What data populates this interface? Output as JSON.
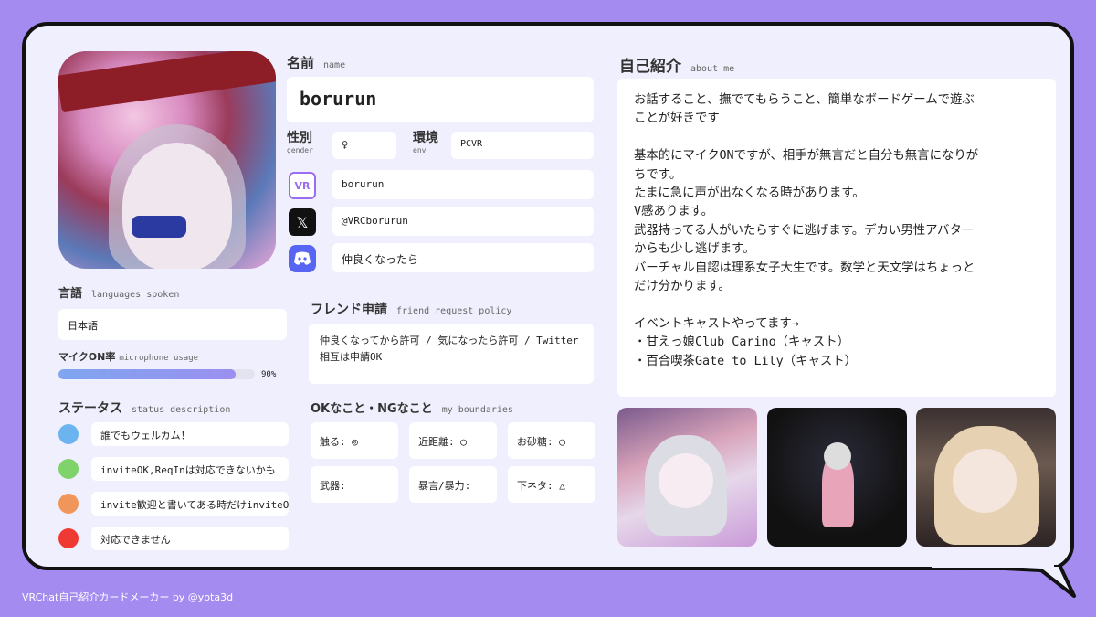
{
  "name": {
    "label": "名前",
    "sub": "name",
    "value": "borurun"
  },
  "gender": {
    "label": "性別",
    "sub": "gender",
    "value": "♀"
  },
  "env": {
    "label": "環境",
    "sub": "env",
    "value": "PCVR"
  },
  "accounts": {
    "vrchat": {
      "icon": "vrchat-icon",
      "icon_text": "VR",
      "value": "borurun"
    },
    "twitter": {
      "icon": "x-icon",
      "icon_text": "𝕏",
      "value": "@VRCborurun"
    },
    "discord": {
      "icon": "discord-icon",
      "value": "仲良くなったら"
    }
  },
  "languages": {
    "label": "言語",
    "sub": "languages spoken",
    "value": "日本語"
  },
  "mic": {
    "label": "マイクON率",
    "sub": "microphone usage",
    "percent": 90,
    "percent_text": "90%"
  },
  "status": {
    "label": "ステータス",
    "sub": "status description",
    "items": [
      {
        "color": "#6cb4f0",
        "text": "誰でもウェルカム！"
      },
      {
        "color": "#7fd36a",
        "text": "inviteOK,ReqInは対応できないかも"
      },
      {
        "color": "#f0965a",
        "text": "invite歓迎と書いてある時だけinviteOK"
      },
      {
        "color": "#ee3a32",
        "text": "対応できません"
      }
    ]
  },
  "friend": {
    "label": "フレンド申請",
    "sub": "friend request policy",
    "value": "仲良くなってから許可 / 気になったら許可 / Twitter相互は申請OK"
  },
  "boundaries": {
    "label": "OKなこと・NGなこと",
    "sub": "my boundaries",
    "items": [
      "触る: ◎",
      "近距離: ◯",
      "お砂糖: ◯",
      "武器:",
      "暴言/暴力:",
      "下ネタ: △"
    ]
  },
  "about": {
    "label": "自己紹介",
    "sub": "about me",
    "lines": [
      "お話すること、撫でてもらうこと、簡単なボードゲームで遊ぶ",
      "ことが好きです",
      "",
      "基本的にマイクONですが、相手が無言だと自分も無言になりが",
      "ちです。",
      "たまに急に声が出なくなる時があります。",
      "V感あります。",
      "武器持ってる人がいたらすぐに逃げます。デカい男性アバター",
      "からも少し逃げます。",
      "バーチャル自認は理系女子大生です。数学と天文学はちょっと",
      "だけ分かります。",
      "",
      "イベントキャストやってます→",
      "・甘えっ娘Club Carino（キャスト）",
      "・百合喫茶Gate to Lily（キャスト）"
    ]
  },
  "footer": "VRChat自己紹介カードメーカー by @yota3d",
  "colors": {
    "accent": "#a48bf0",
    "card_bg": "#f0effd",
    "border": "#111111"
  }
}
